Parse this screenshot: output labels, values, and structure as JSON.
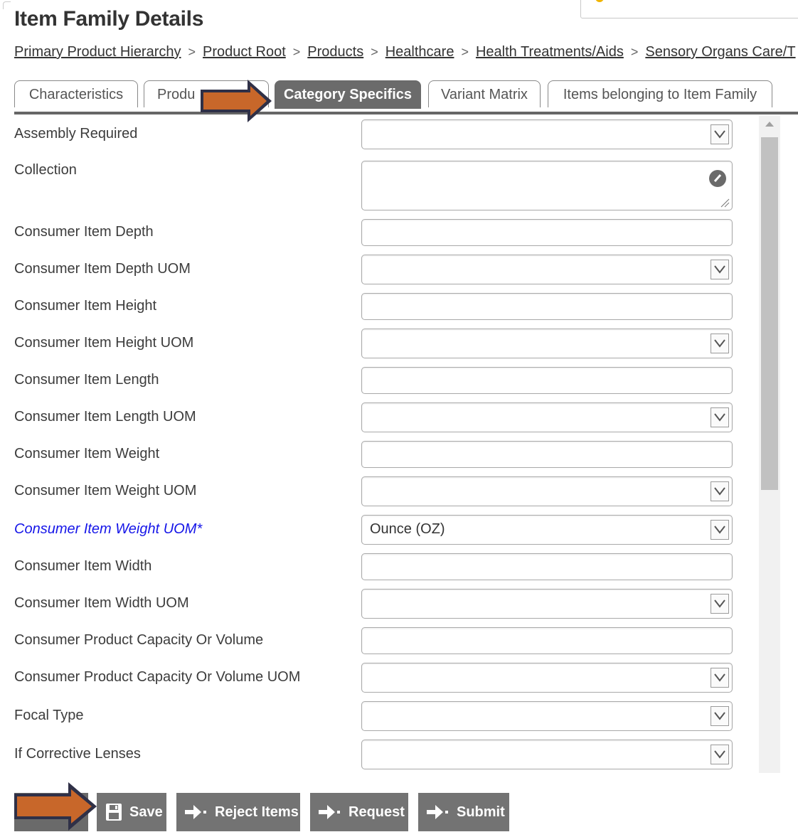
{
  "page_title": "Item Family Details",
  "breadcrumb": [
    "Primary Product Hierarchy",
    "Product Root",
    "Products",
    "Healthcare",
    "Health Treatments/Aids",
    "Sensory Organs Care/T"
  ],
  "breadcrumb_separator": ">",
  "tabs": [
    {
      "label": "Characteristics"
    },
    {
      "label": "Produ"
    },
    {
      "label": "Category Specifics",
      "active": true
    },
    {
      "label": "Variant Matrix"
    },
    {
      "label": "Items belonging to Item Family"
    }
  ],
  "fields": [
    {
      "label": "Assembly Required",
      "type": "select",
      "value": ""
    },
    {
      "label": "Collection",
      "type": "textarea",
      "value": ""
    },
    {
      "label": "Consumer Item Depth",
      "type": "text",
      "value": ""
    },
    {
      "label": "Consumer Item Depth UOM",
      "type": "select",
      "value": ""
    },
    {
      "label": "Consumer Item Height",
      "type": "text",
      "value": ""
    },
    {
      "label": "Consumer Item Height UOM",
      "type": "select",
      "value": ""
    },
    {
      "label": "Consumer Item Length",
      "type": "text",
      "value": ""
    },
    {
      "label": "Consumer Item Length UOM",
      "type": "select",
      "value": ""
    },
    {
      "label": "Consumer Item Weight",
      "type": "text",
      "value": ""
    },
    {
      "label": "Consumer Item Weight UOM",
      "type": "select",
      "value": ""
    },
    {
      "label": "Consumer Item Weight UOM*",
      "type": "select",
      "value": "Ounce (OZ)",
      "required": true
    },
    {
      "label": "Consumer Item Width",
      "type": "text",
      "value": ""
    },
    {
      "label": "Consumer Item Width UOM",
      "type": "select",
      "value": ""
    },
    {
      "label": "Consumer Product Capacity Or Volume",
      "type": "text",
      "value": ""
    },
    {
      "label": "Consumer Product Capacity Or Volume UOM",
      "type": "select",
      "value": ""
    },
    {
      "label": "Focal Type",
      "type": "select",
      "value": ""
    },
    {
      "label": "If Corrective Lenses",
      "type": "select",
      "value": ""
    }
  ],
  "buttons": [
    {
      "label": "Save",
      "icon": "save-icon"
    },
    {
      "label": "Reject Items",
      "icon": "forward-arrow-icon"
    },
    {
      "label": "Request",
      "icon": "forward-arrow-icon"
    },
    {
      "label": "Submit",
      "icon": "forward-arrow-icon"
    }
  ],
  "colors": {
    "active_tab": "#6b6b6b",
    "button": "#737373",
    "required_label": "#1515e8",
    "annotation_arrow_fill": "#c8672a",
    "annotation_arrow_outline": "#2f3047"
  }
}
